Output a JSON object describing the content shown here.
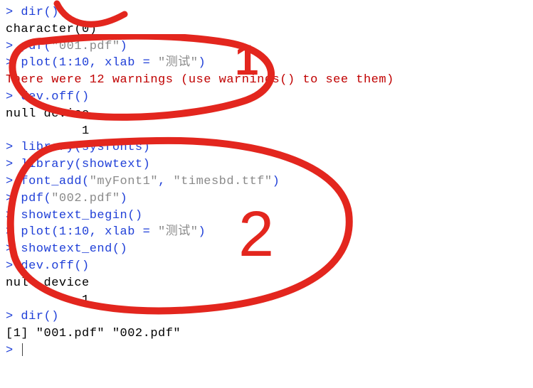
{
  "colors": {
    "input": "#2040d8",
    "output": "#000000",
    "error": "#c00000",
    "string_literal": "#8a8a8a",
    "annotation": "#e3261e"
  },
  "console": {
    "lines": [
      {
        "type": "input",
        "prompt": "> ",
        "code": "dir()"
      },
      {
        "type": "output",
        "text": "character(0)"
      },
      {
        "type": "input",
        "prompt": "> ",
        "code_pre": "pdf(",
        "string": "\"001.pdf\"",
        "code_post": ")"
      },
      {
        "type": "input",
        "prompt": "> ",
        "code_pre": "plot(1:10, xlab = ",
        "string": "\"测试\"",
        "code_post": ")"
      },
      {
        "type": "error",
        "text": "There were 12 warnings (use warnings() to see them)"
      },
      {
        "type": "input",
        "prompt": "> ",
        "code": "dev.off()"
      },
      {
        "type": "output",
        "text": "null device "
      },
      {
        "type": "output",
        "text": "          1 "
      },
      {
        "type": "input",
        "prompt": "> ",
        "code": "library(sysfonts)"
      },
      {
        "type": "input",
        "prompt": "> ",
        "code": "library(showtext)"
      },
      {
        "type": "input",
        "prompt": "> ",
        "code_pre": "font_add(",
        "string": "\"myFont1\"",
        "code_mid": ", ",
        "string2": "\"timesbd.ttf\"",
        "code_post": ")"
      },
      {
        "type": "input",
        "prompt": "> ",
        "code_pre": "pdf(",
        "string": "\"002.pdf\"",
        "code_post": ")"
      },
      {
        "type": "input",
        "prompt": "> ",
        "code": "showtext_begin()"
      },
      {
        "type": "input",
        "prompt": "> ",
        "code_pre": "plot(1:10, xlab = ",
        "string": "\"测试\"",
        "code_post": ")"
      },
      {
        "type": "input",
        "prompt": "> ",
        "code": "showtext_end()"
      },
      {
        "type": "input",
        "prompt": "> ",
        "code": "dev.off()"
      },
      {
        "type": "output",
        "text": "null device "
      },
      {
        "type": "output",
        "text": "          1 "
      },
      {
        "type": "input",
        "prompt": "> ",
        "code": "dir()"
      },
      {
        "type": "output",
        "text": "[1] \"001.pdf\" \"002.pdf\""
      },
      {
        "type": "input",
        "prompt": "> ",
        "code": "",
        "cursor": true
      }
    ]
  },
  "annotations": {
    "label1": "1",
    "label2": "2"
  }
}
